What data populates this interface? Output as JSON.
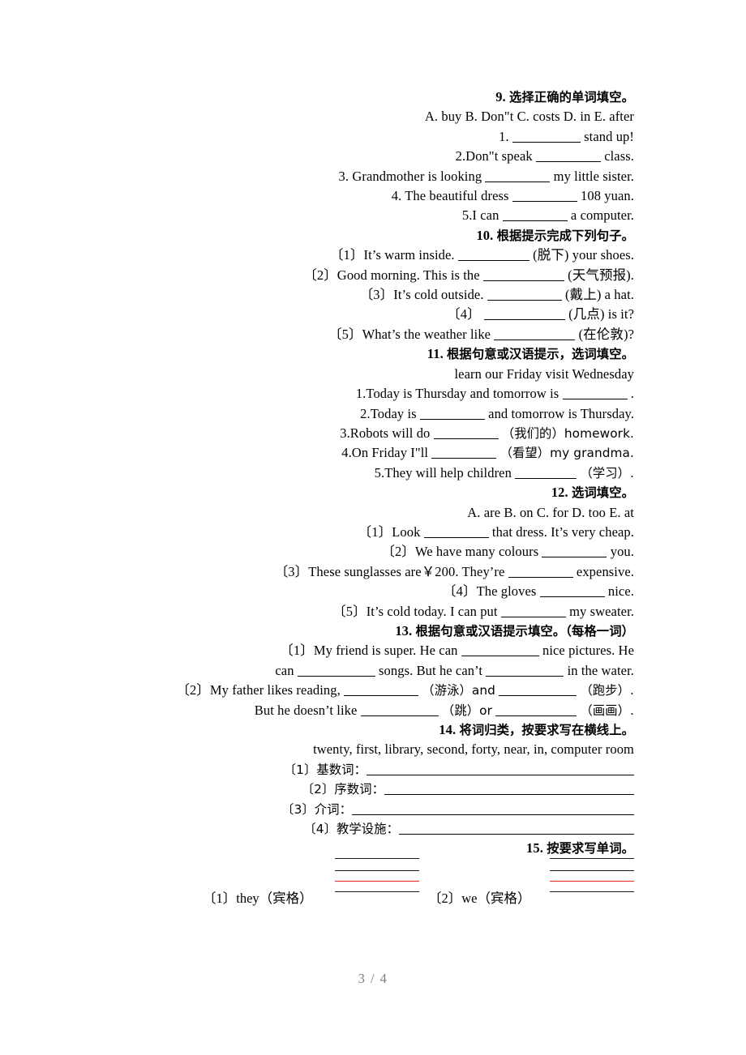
{
  "document": {
    "page_label": "3 / 4"
  },
  "sections": [
    {
      "id": "q9",
      "heading_number": "9.",
      "heading_text": "选择正确的单词填空。",
      "options": "A. buy  B. Don\"t  C. costs  D. in  E. after",
      "items": [
        {
          "before": "1.",
          "after": "stand up!"
        },
        {
          "before": "2.Don\"t speak",
          "after": "class."
        },
        {
          "before": "3. Grandmother is looking",
          "after": "my little sister."
        },
        {
          "before": "4. The beautiful dress",
          "after": "108 yuan."
        },
        {
          "before": "5.I can",
          "after": "a computer."
        }
      ]
    },
    {
      "id": "q10",
      "heading_number": "10.",
      "heading_text": "根据提示完成下列句子。",
      "items": [
        {
          "before": "〔1〕It’s warm inside.",
          "after": "(脱下) your shoes."
        },
        {
          "before": "〔2〕Good morning. This is the",
          "after": "(天气预报)."
        },
        {
          "before": "〔3〕It’s cold outside.",
          "after": "(戴上) a hat."
        },
        {
          "before": "〔4〕",
          "after": "(几点) is it?"
        },
        {
          "before": "〔5〕What’s the weather like",
          "after": "(在伦敦)?"
        }
      ]
    },
    {
      "id": "q11",
      "heading_number": "11.",
      "heading_text": "根据句意或汉语提示，选词填空。",
      "options": "learn  our  Friday  visit  Wednesday",
      "items": [
        {
          "before": "1.Today is Thursday and tomorrow is",
          "after": "."
        },
        {
          "before": "2.Today is",
          "after": "and tomorrow is Thursday."
        },
        {
          "before": "3.Robots will do",
          "after": "（我们的）homework."
        },
        {
          "before": "4.On Friday I\"ll",
          "after": "（看望）my grandma."
        },
        {
          "before": "5.They will help children",
          "after": "（学习）."
        }
      ]
    },
    {
      "id": "q12",
      "heading_number": "12.",
      "heading_text": "选词填空。",
      "options": "A. are  B. on C. for  D. too E. at",
      "items": [
        {
          "before": "〔1〕Look",
          "after": "that dress. It’s very cheap."
        },
        {
          "before": "〔2〕We have many colours",
          "after": "you."
        },
        {
          "before": "〔3〕These sunglasses are￥200. They’re",
          "after": "expensive."
        },
        {
          "before": "〔4〕The gloves",
          "after": "nice."
        },
        {
          "before": "〔5〕It’s cold today. I can put",
          "after": "my sweater."
        }
      ]
    },
    {
      "id": "q13",
      "heading_number": "13.",
      "heading_text": "根据句意或汉语提示填空。（每格一词）",
      "lines": [
        {
          "a": "〔1〕My friend is super. He can",
          "b": "nice pictures. He"
        },
        {
          "a": "can",
          "b": "songs. But he can’t",
          "c": "in the water."
        },
        {
          "a": "〔2〕My father likes reading,",
          "b": "（游泳）and",
          "c": "（跑步）."
        },
        {
          "a": "But he doesn’t like",
          "b": "（跳）or",
          "c": "（画画）."
        }
      ]
    },
    {
      "id": "q14",
      "heading_number": "14.",
      "heading_text": "将词归类，按要求写在横线上。",
      "word_bank": "twenty, first, library, second, forty, near, in, computer room",
      "items": [
        {
          "label": "〔1〕基数词："
        },
        {
          "label": "〔2〕序数词："
        },
        {
          "label": "〔3〕介词："
        },
        {
          "label": "〔4〕教学设施："
        }
      ]
    },
    {
      "id": "q15",
      "heading_number": "15.",
      "heading_text": "按要求写单词。",
      "items": [
        {
          "label": "〔1〕they（宾格）"
        },
        {
          "label": "〔2〕we（宾格）"
        }
      ]
    }
  ],
  "colors": {
    "text": "#000000",
    "grid_line": "#1a1a1a",
    "grid_red_line": "#e8241b",
    "footer": "#7d7d7d"
  }
}
